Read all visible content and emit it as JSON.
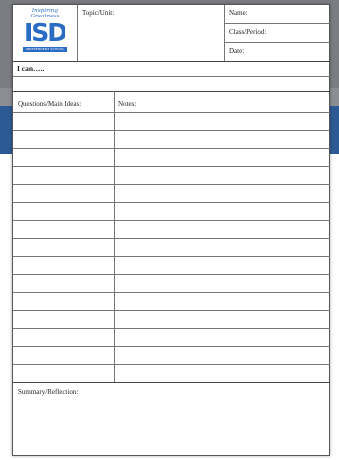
{
  "header": {
    "logo_script": "Inspiring Greatness",
    "logo_letters": "ISD",
    "logo_subtitle": "INDEPENDENT SCHOOL DISTRICT",
    "topic_label": "Topic/Unit:",
    "name_label": "Name:",
    "class_label": "Class/Period:",
    "date_label": "Date:"
  },
  "objective": {
    "label": "I can….."
  },
  "notes": {
    "questions_label": "Questions/Main Ideas:",
    "notes_label": "Notes:",
    "row_count": 15
  },
  "summary": {
    "label": "Summary/Reflection:"
  },
  "colors": {
    "logo_blue": "#2a6bc4",
    "backdrop_gray": "#7a7d82",
    "backdrop_blue": "#2d5a94"
  }
}
